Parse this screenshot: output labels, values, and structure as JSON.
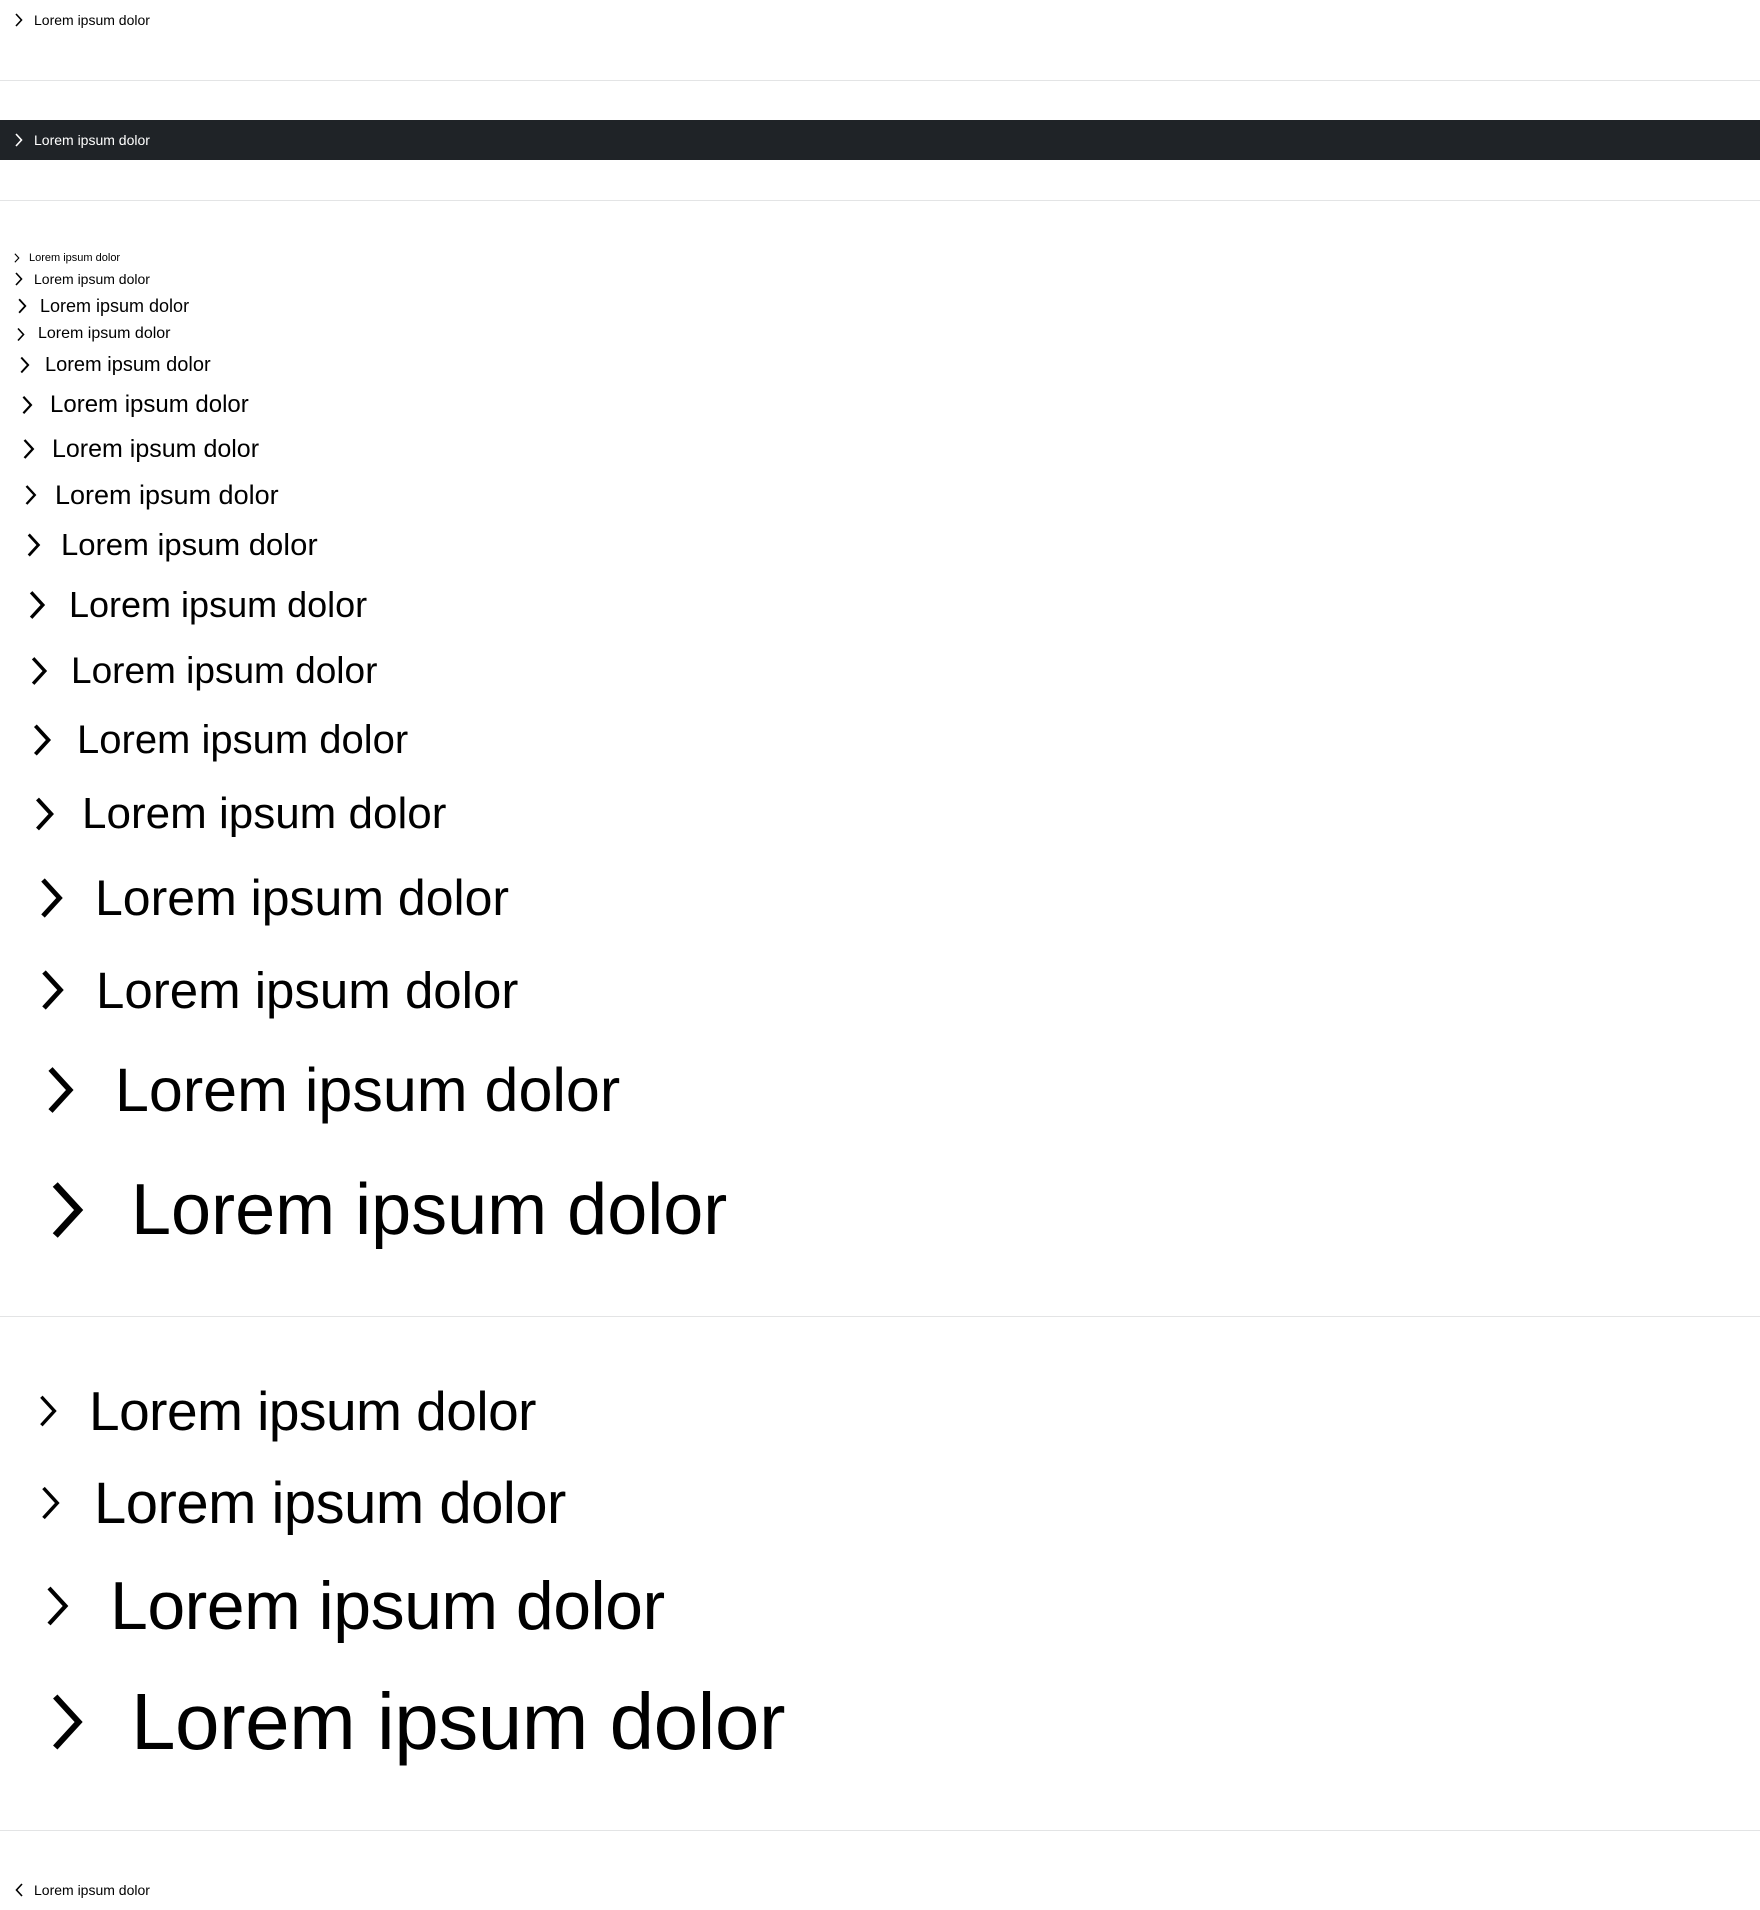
{
  "colors": {
    "background": "#ffffff",
    "text": "#000000",
    "dark_background": "#1f2327",
    "dark_text": "#ffffff",
    "divider": "#e3e4e5"
  },
  "sections": {
    "default": {
      "link": {
        "label": "Lorem ipsum dolor",
        "icon": "chevron-right-icon"
      }
    },
    "theme_dark": {
      "link": {
        "label": "Lorem ipsum dolor",
        "icon": "chevron-right-icon"
      }
    },
    "sizes": {
      "links": [
        {
          "label": "Lorem ipsum dolor",
          "icon": "chevron-right-icon"
        },
        {
          "label": "Lorem ipsum dolor",
          "icon": "chevron-right-icon"
        },
        {
          "label": "Lorem ipsum dolor",
          "icon": "chevron-right-icon"
        },
        {
          "label": "Lorem ipsum dolor",
          "icon": "chevron-right-icon"
        },
        {
          "label": "Lorem ipsum dolor",
          "icon": "chevron-right-icon"
        },
        {
          "label": "Lorem ipsum dolor",
          "icon": "chevron-right-icon"
        },
        {
          "label": "Lorem ipsum dolor",
          "icon": "chevron-right-icon"
        },
        {
          "label": "Lorem ipsum dolor",
          "icon": "chevron-right-icon"
        },
        {
          "label": "Lorem ipsum dolor",
          "icon": "chevron-right-icon"
        },
        {
          "label": "Lorem ipsum dolor",
          "icon": "chevron-right-icon"
        },
        {
          "label": "Lorem ipsum dolor",
          "icon": "chevron-right-icon"
        },
        {
          "label": "Lorem ipsum dolor",
          "icon": "chevron-right-icon"
        },
        {
          "label": "Lorem ipsum dolor",
          "icon": "chevron-right-icon"
        },
        {
          "label": "Lorem ipsum dolor",
          "icon": "chevron-right-icon"
        },
        {
          "label": "Lorem ipsum dolor",
          "icon": "chevron-right-icon"
        },
        {
          "label": "Lorem ipsum dolor",
          "icon": "chevron-right-icon"
        },
        {
          "label": "Lorem ipsum dolor",
          "icon": "chevron-right-icon"
        }
      ]
    },
    "thin_weight": {
      "links": [
        {
          "label": "Lorem ipsum dolor",
          "icon": "chevron-right-icon"
        },
        {
          "label": "Lorem ipsum dolor",
          "icon": "chevron-right-icon"
        },
        {
          "label": "Lorem ipsum dolor",
          "icon": "chevron-right-icon"
        },
        {
          "label": "Lorem ipsum dolor",
          "icon": "chevron-right-icon"
        }
      ]
    },
    "back_link": {
      "link": {
        "label": "Lorem ipsum dolor",
        "icon": "chevron-left-icon"
      }
    }
  }
}
